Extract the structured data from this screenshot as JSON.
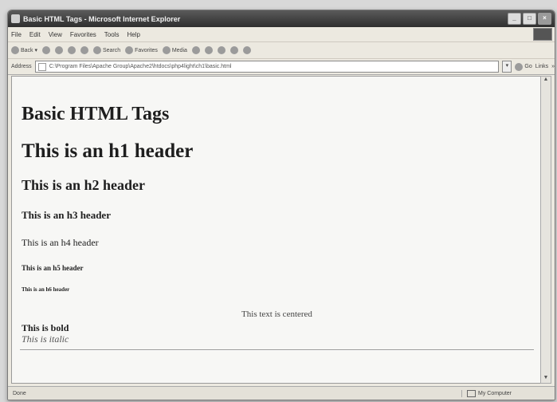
{
  "window": {
    "title": "Basic HTML Tags - Microsoft Internet Explorer"
  },
  "menubar": {
    "items": [
      "File",
      "Edit",
      "View",
      "Favorites",
      "Tools",
      "Help"
    ]
  },
  "toolbar": {
    "back": "Back",
    "search": "Search",
    "favorites": "Favorites",
    "media": "Media"
  },
  "address": {
    "label": "Address",
    "value": "C:\\Program Files\\Apache Group\\Apache2\\htdocs\\php4light\\ch1\\basic.html",
    "go": "Go",
    "links": "Links"
  },
  "page": {
    "title": "Basic HTML Tags",
    "h1": "This is an h1 header",
    "h2": "This is an h2 header",
    "h3": "This is an h3 header",
    "h4": "This is an h4 header",
    "h5": "This is an h5 header",
    "h6": "This is an h6 header",
    "centered": "This text is centered",
    "bold": "This is bold",
    "italic": "This is italic"
  },
  "status": {
    "left": "Done",
    "zone": "My Computer"
  }
}
